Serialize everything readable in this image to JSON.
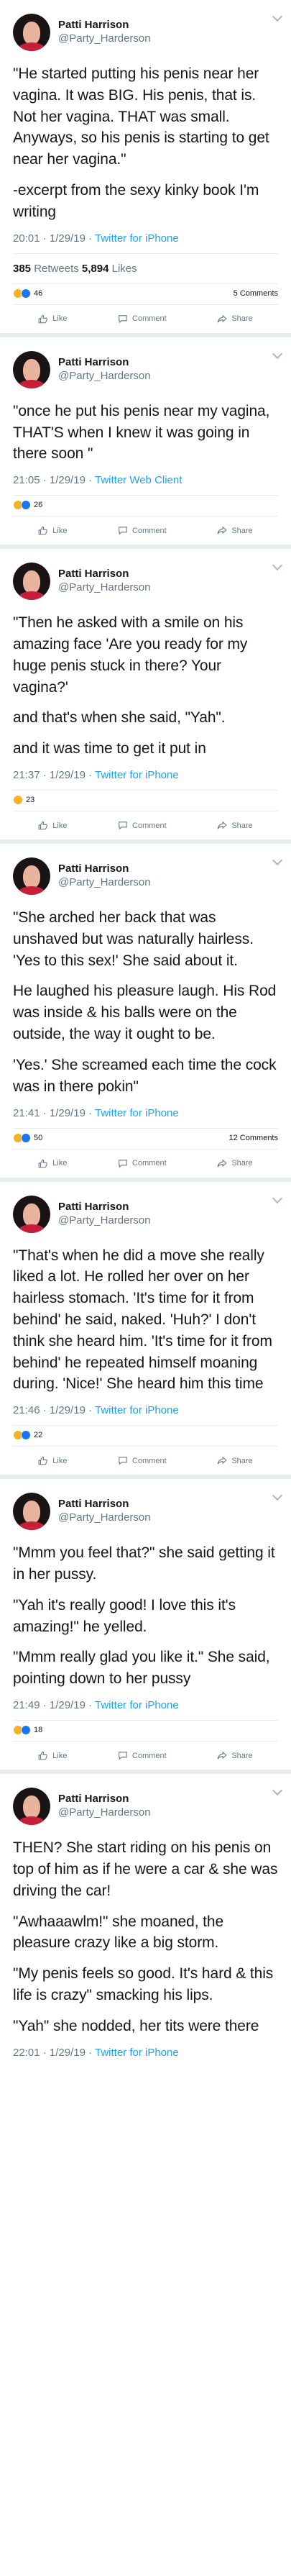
{
  "account": {
    "name": "Patti Harrison",
    "handle": "@Party_Harderson"
  },
  "labels": {
    "like": "Like",
    "comment": "Comment",
    "share": "Share",
    "retweets": "Retweets",
    "likes": "Likes"
  },
  "tweets": [
    {
      "paragraphs": [
        "\"He started putting his penis near her vagina. It was BIG. His penis, that is. Not her vagina. THAT was small. Anyways, so his penis is starting to get near her vagina.\"",
        "-excerpt from the sexy kinky book I'm writing"
      ],
      "time": "20:01 · 1/29/19 ·",
      "source": "Twitter for iPhone",
      "retweet_count": "385",
      "like_count": "5,894",
      "reactions": [
        "haha",
        "like"
      ],
      "reaction_count": "46",
      "comments": "5 Comments"
    },
    {
      "paragraphs": [
        "\"once he put his penis near my vagina, THAT'S when I knew it was going in there soon \""
      ],
      "time": "21:05 · 1/29/19 ·",
      "source": "Twitter Web Client",
      "reactions": [
        "haha",
        "like"
      ],
      "reaction_count": "26",
      "comments": ""
    },
    {
      "paragraphs": [
        "\"Then he asked with a smile on his amazing face 'Are you ready for my huge penis stuck in there? Your vagina?'",
        "and that's when she said, \"Yah\".",
        "and it was time to get it put in"
      ],
      "time": "21:37 · 1/29/19 ·",
      "source": "Twitter for iPhone",
      "reactions": [
        "haha"
      ],
      "reaction_count": "23",
      "comments": ""
    },
    {
      "paragraphs": [
        "\"She arched her back that was unshaved but was naturally hairless. 'Yes to this sex!' She said about it.",
        "He laughed his pleasure laugh. His Rod was inside & his balls were on the outside, the way it ought to be.",
        "'Yes.' She screamed each time the cock was in there pokin\""
      ],
      "time": "21:41 · 1/29/19 ·",
      "source": "Twitter for iPhone",
      "reactions": [
        "haha",
        "like"
      ],
      "reaction_count": "50",
      "comments": "12 Comments"
    },
    {
      "paragraphs": [
        "\"That's when he did a move she really liked a lot. He rolled her over on her hairless stomach. 'It's time for it from behind' he said, naked. 'Huh?' I don't think she heard him. 'It's time for it from behind' he repeated himself moaning during. 'Nice!' She heard him this time"
      ],
      "time": "21:46 · 1/29/19 ·",
      "source": "Twitter for iPhone",
      "reactions": [
        "haha",
        "like"
      ],
      "reaction_count": "22",
      "comments": ""
    },
    {
      "paragraphs": [
        "\"Mmm you feel that?\" she said getting it in her pussy.",
        "\"Yah it's really good! I love this it's amazing!\" he yelled.",
        "\"Mmm really glad you like it.\" She said, pointing down to her pussy"
      ],
      "time": "21:49 · 1/29/19 ·",
      "source": "Twitter for iPhone",
      "reactions": [
        "wow",
        "like"
      ],
      "reaction_count": "18",
      "comments": ""
    },
    {
      "paragraphs": [
        "THEN? She start riding on his penis on top of him as if he were a car & she was driving the car!",
        "\"Awhaaawlm!\" she moaned, the pleasure crazy like a big storm.",
        "\"My penis feels so good. It's hard & this life is crazy\" smacking his lips.",
        "\"Yah\" she nodded, her tits were there"
      ],
      "time": "22:01 · 1/29/19 ·",
      "source": "Twitter for iPhone",
      "reactions": [],
      "reaction_count": "",
      "comments": ""
    }
  ]
}
